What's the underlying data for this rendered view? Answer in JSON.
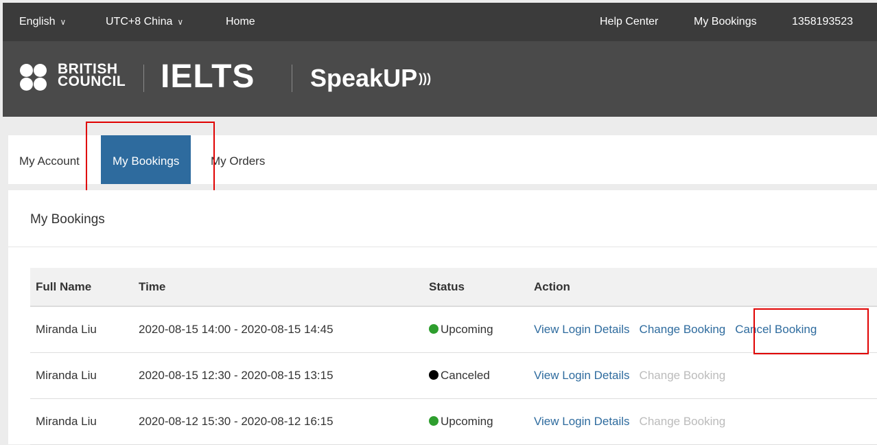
{
  "topbar": {
    "language": "English",
    "timezone": "UTC+8 China",
    "home": "Home",
    "help_center": "Help Center",
    "my_bookings": "My Bookings",
    "phone": "1358193523"
  },
  "brand": {
    "british_council": [
      "BRITISH",
      "COUNCIL"
    ],
    "ielts": "IELTS",
    "speakup": "SpeakUP"
  },
  "tabs": [
    {
      "label": "My Account",
      "active": false
    },
    {
      "label": "My Bookings",
      "active": true
    },
    {
      "label": "My Orders",
      "active": false
    }
  ],
  "panel": {
    "title": "My Bookings",
    "columns": [
      "Full Name",
      "Time",
      "Status",
      "Action"
    ],
    "rows": [
      {
        "name": "Miranda Liu",
        "time": "2020-08-15 14:00 - 2020-08-15 14:45",
        "status": "Upcoming",
        "status_color": "#2e9e2e",
        "actions": [
          {
            "label": "View Login Details",
            "enabled": true
          },
          {
            "label": "Change Booking",
            "enabled": true
          },
          {
            "label": "Cancel Booking",
            "enabled": true
          }
        ]
      },
      {
        "name": "Miranda Liu",
        "time": "2020-08-15 12:30 - 2020-08-15 13:15",
        "status": "Canceled",
        "status_color": "#000000",
        "actions": [
          {
            "label": "View Login Details",
            "enabled": true
          },
          {
            "label": "Change Booking",
            "enabled": false
          }
        ]
      },
      {
        "name": "Miranda Liu",
        "time": "2020-08-12 15:30 - 2020-08-12 16:15",
        "status": "Upcoming",
        "status_color": "#2e9e2e",
        "actions": [
          {
            "label": "View Login Details",
            "enabled": true
          },
          {
            "label": "Change Booking",
            "enabled": false
          }
        ]
      }
    ]
  },
  "colors": {
    "accent": "#2e6b9e",
    "highlight": "#e00000"
  }
}
